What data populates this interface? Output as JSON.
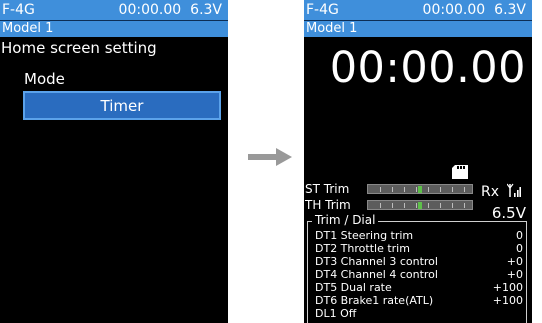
{
  "left_screen": {
    "status": {
      "device": "F-4G",
      "time": "00:00.00",
      "voltage": "6.3V"
    },
    "model": "Model 1",
    "title": "Home screen setting",
    "mode_label": "Mode",
    "mode_value": "Timer"
  },
  "arrow_icon": "arrow-right-icon",
  "right_screen": {
    "status": {
      "device": "F-4G",
      "time": "00:00.00",
      "voltage": "6.3V"
    },
    "model": "Model 1",
    "timer": "00:00.00",
    "st_trim_label": "ST Trim",
    "th_trim_label": "TH Trim",
    "rx_label": "Rx",
    "rx_voltage": "6.5V",
    "dial_heading": "Trim / Dial",
    "dials": [
      {
        "name": "DT1 Steering trim",
        "value": "0"
      },
      {
        "name": "DT2 Throttle trim",
        "value": "0"
      },
      {
        "name": "DT3 Channel 3 control",
        "value": "+0"
      },
      {
        "name": "DT4 Channel 4 control",
        "value": "+0"
      },
      {
        "name": "DT5 Dual rate",
        "value": "+100"
      },
      {
        "name": "DT6 Brake1 rate(ATL)",
        "value": "+100"
      },
      {
        "name": "DL1 Off",
        "value": ""
      }
    ]
  },
  "colors": {
    "header_blue": "#3f8fdb",
    "select_blue": "#2a6cbf",
    "trim_marker_green": "#5ec04a",
    "arrow_gray": "#999999"
  }
}
